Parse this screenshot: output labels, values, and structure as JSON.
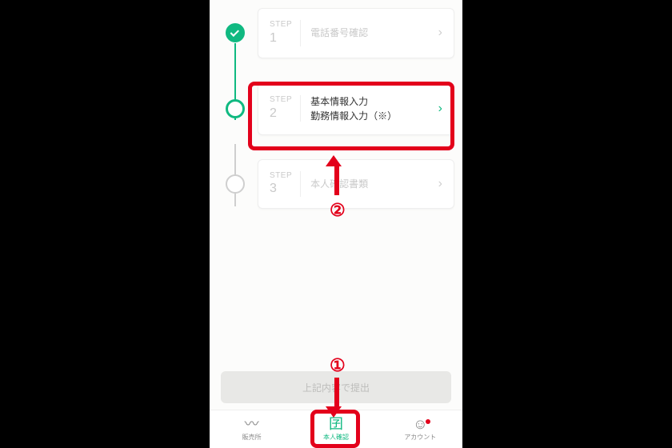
{
  "steps": [
    {
      "word": "STEP",
      "num": "1",
      "title": "電話番号確認",
      "state": "done"
    },
    {
      "word": "STEP",
      "num": "2",
      "title1": "基本情報入力",
      "title2": "勤務情報入力（※）",
      "state": "current"
    },
    {
      "word": "STEP",
      "num": "3",
      "title": "本人確認書類",
      "state": "pending"
    }
  ],
  "submit_label": "上記内容で提出",
  "annotations": {
    "callout_1": "①",
    "callout_2": "②"
  },
  "tabs": [
    {
      "label": "販売所",
      "icon": "〰",
      "active": false,
      "badge": false
    },
    {
      "label": "本人確認",
      "icon": "囝",
      "active": true,
      "badge": false
    },
    {
      "label": "アカウント",
      "icon": "☺",
      "active": false,
      "badge": true
    }
  ],
  "colors": {
    "accent": "#10b981",
    "highlight": "#e3001b"
  }
}
